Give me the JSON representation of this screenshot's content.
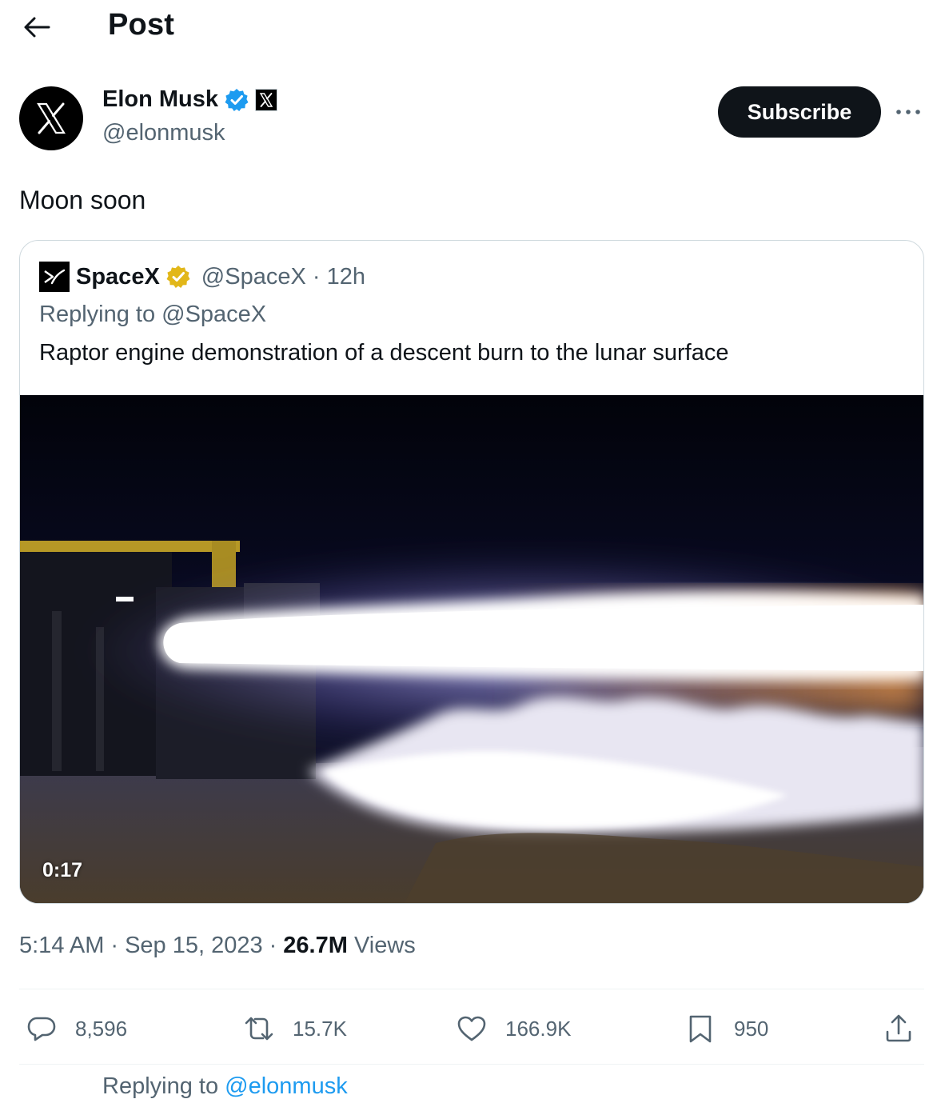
{
  "header": {
    "title": "Post"
  },
  "author": {
    "name": "Elon Musk",
    "handle": "@elonmusk",
    "subscribe_label": "Subscribe"
  },
  "post": {
    "text": "Moon soon"
  },
  "quote": {
    "name": "SpaceX",
    "handle_time": "@SpaceX · 12h",
    "replying": "Replying to @SpaceX",
    "text": "Raptor engine demonstration of a descent burn to the lunar surface",
    "video_duration": "0:17"
  },
  "meta": {
    "time": "5:14 AM",
    "sep": "·",
    "date": "Sep 15, 2023",
    "views_count": "26.7M",
    "views_label": "Views"
  },
  "actions": {
    "replies": "8,596",
    "reposts": "15.7K",
    "likes": "166.9K",
    "bookmarks": "950"
  },
  "reply_context": {
    "prefix": "Replying to",
    "mention": "@elonmusk"
  },
  "colors": {
    "text": "#0f1419",
    "secondary": "#536471",
    "link": "#1d9bf0",
    "verified_blue": "#1d9bf0",
    "verified_gold": "#e2b719"
  }
}
